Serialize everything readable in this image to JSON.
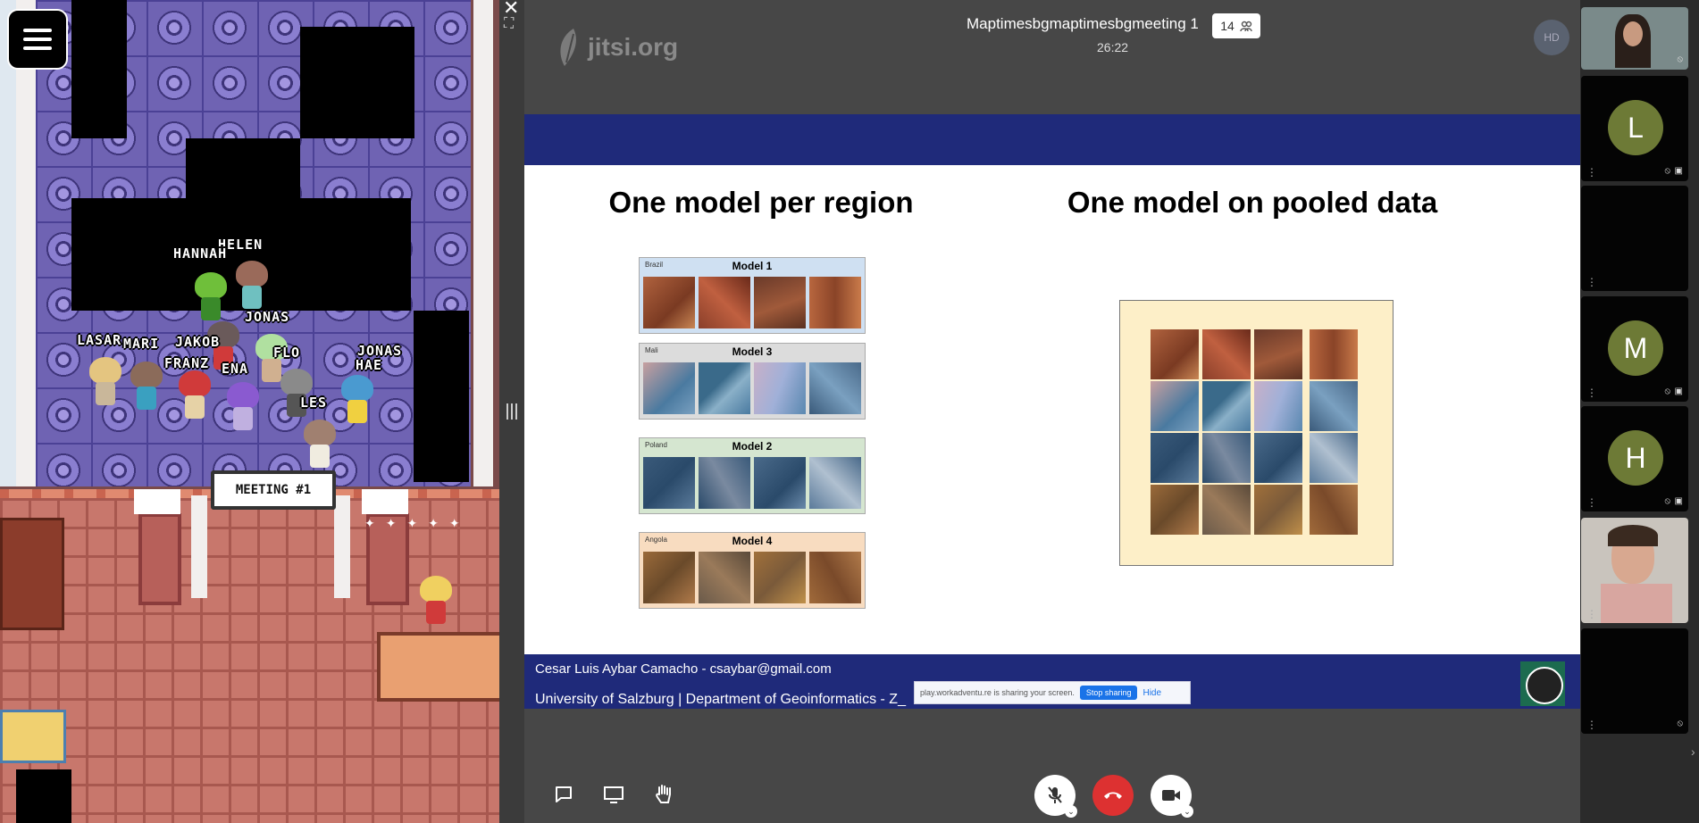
{
  "game": {
    "menu_icon": "hamburger-menu-icon",
    "meeting_sign": "MEETING #1",
    "close_glyph": "✕",
    "fullscreen_glyph": "⛶",
    "players": [
      {
        "name": "HELEN"
      },
      {
        "name": "HANNAH"
      },
      {
        "name": "JONAS"
      },
      {
        "name": "LASAR"
      },
      {
        "name": "MARI"
      },
      {
        "name": "JAKOB"
      },
      {
        "name": "FRANZ"
      },
      {
        "name": "ENA"
      },
      {
        "name": "FLO"
      },
      {
        "name": "JONAS"
      },
      {
        "name": "HAE"
      },
      {
        "name": "LES"
      }
    ]
  },
  "splitter": {
    "icon": "drag-handle-icon"
  },
  "jitsi": {
    "logo_text": "jitsi.org",
    "meeting_title": "Maptimesbgmaptimesbgmeeting 1",
    "timer": "26:22",
    "participant_count": "14",
    "hd_label": "HD"
  },
  "slide": {
    "left_title": "One model per region",
    "right_title": "One model on pooled data",
    "models": [
      {
        "label": "Model 1",
        "country": "Brazil"
      },
      {
        "label": "Model 3",
        "country": "Mali"
      },
      {
        "label": "Model 2",
        "country": "Poland"
      },
      {
        "label": "Model 4",
        "country": "Angola"
      }
    ],
    "footer_line1": "Cesar Luis Aybar Camacho - csaybar@gmail.com",
    "footer_line2": "University of Salzburg | Department of Geoinformatics - Z_"
  },
  "share_bar": {
    "message": "play.workadventu.re is sharing your screen.",
    "stop_label": "Stop sharing",
    "hide_label": "Hide"
  },
  "filmstrip": {
    "tiles": [
      {
        "kind": "video",
        "initial": ""
      },
      {
        "kind": "avatar",
        "initial": "L"
      },
      {
        "kind": "blank",
        "initial": ""
      },
      {
        "kind": "avatar",
        "initial": "M"
      },
      {
        "kind": "avatar",
        "initial": "H"
      },
      {
        "kind": "video",
        "initial": ""
      },
      {
        "kind": "blank",
        "initial": ""
      }
    ]
  },
  "colors": {
    "slide_blue": "#1f2a7a",
    "hangup_red": "#dd3131",
    "avatar_olive": "#6d7a36"
  }
}
